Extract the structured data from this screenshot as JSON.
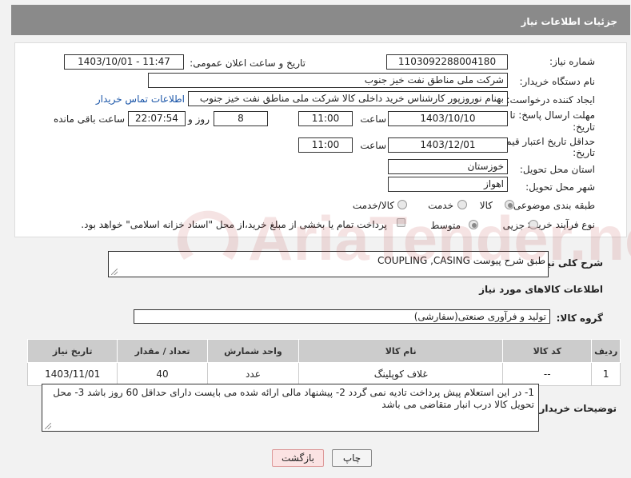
{
  "header": {
    "title": "جزئیات اطلاعات نیاز"
  },
  "form": {
    "need_number_label": "شماره نیاز:",
    "need_number": "1103092288004180",
    "announce_label": "تاریخ و ساعت اعلان عمومی:",
    "announce_value": "1403/10/01 - 11:47",
    "buyer_org_label": "نام دستگاه خریدار:",
    "buyer_org": "شرکت ملی مناطق نفت خیز جنوب",
    "requester_label": "ایجاد کننده درخواست:",
    "requester": "بهنام  نوروزپور کارشناس خرید داخلی کالا شرکت ملی مناطق نفت خیز جنوب",
    "buyer_contact_link": "اطلاعات تماس خریدار",
    "deadline_label": "مهلت ارسال پاسخ: تا",
    "deadline_label_2": "تاریخ:",
    "deadline_date": "1403/10/10",
    "time_label": "ساعت",
    "deadline_time": "11:00",
    "days_value": "8",
    "days_label": "روز و",
    "remaining_time": "22:07:54",
    "remaining_label": "ساعت باقی مانده",
    "validity_label": "حداقل تاریخ اعتبار قیمت: تا",
    "validity_label_2": "تاریخ:",
    "validity_date": "1403/12/01",
    "validity_time": "11:00",
    "province_label": "استان محل تحویل:",
    "province": "خوزستان",
    "city_label": "شهر محل تحویل:",
    "city": "اهواز",
    "category_label": "طبقه بندی موضوعی:",
    "category_options": [
      "کالا",
      "خدمت",
      "کالا/خدمت"
    ],
    "process_label": "نوع فرآیند خرید :",
    "process_options": [
      "جزیی",
      "متوسط"
    ],
    "payment_note": "پرداخت تمام یا بخشی از مبلغ خرید،از محل \"اسناد خزانه اسلامی\" خواهد بود."
  },
  "description": {
    "label": "شرح کلی نیاز:",
    "text": "COUPLING ,CASING  طبق شرح پیوست"
  },
  "goods": {
    "section_title": "اطلاعات کالاهای مورد نیاز",
    "group_label": "گروه کالا:",
    "group_value": "تولید و فرآوری صنعتی(سفارشی)",
    "columns": [
      "ردیف",
      "کد کالا",
      "نام کالا",
      "واحد شمارش",
      "تعداد / مقدار",
      "تاریخ نیاز"
    ],
    "rows": [
      [
        "1",
        "--",
        "غلاف کوپلینگ",
        "عدد",
        "40",
        "1403/11/01"
      ]
    ]
  },
  "buyer_notes": {
    "label": "توضیحات خریدار:",
    "text": "1-  در این استعلام پیش پرداخت تادیه نمی گردد  2- پیشنهاد مالی ارائه شده می بایست دارای حداقل 60 روز باشد  3- محل تحویل کالا درب انبار متقاضی می باشد"
  },
  "buttons": {
    "print": "چاپ",
    "back": "بازگشت"
  },
  "watermark": {
    "text": "AriaTender.net"
  }
}
